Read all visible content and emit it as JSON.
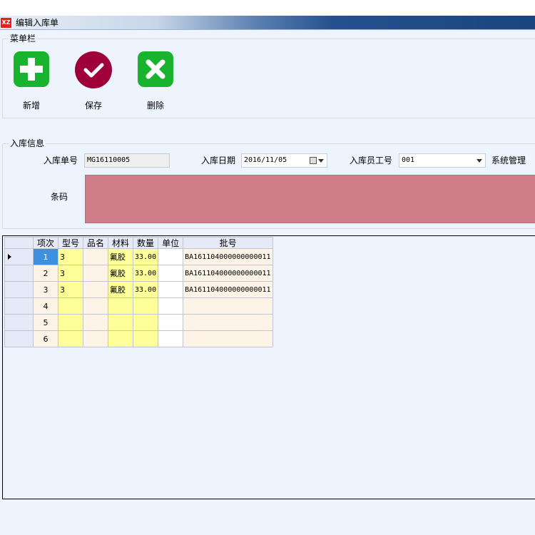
{
  "window": {
    "title": "编辑入库单",
    "app_icon_text": "XZ"
  },
  "menu": {
    "group_label": "菜单栏",
    "add_label": "新增",
    "save_label": "保存",
    "delete_label": "删除",
    "colors": {
      "add": "#1ab32f",
      "save": "#a0003a",
      "delete": "#1ab32f"
    }
  },
  "info": {
    "group_label": "入库信息",
    "order_no_label": "入库单号",
    "order_no_value": "MG16110005",
    "date_label": "入库日期",
    "date_value": "2016/11/05",
    "employee_label": "入库员工号",
    "employee_value": "001",
    "employee_name": "系统管理",
    "barcode_label": "条码",
    "barcode_color": "#cf7d88"
  },
  "grid": {
    "columns": [
      "项次",
      "型号",
      "品名",
      "材料",
      "数量",
      "单位",
      "批号"
    ],
    "rows": [
      {
        "seq": "1",
        "model": "3",
        "name": "",
        "material": "氟胶",
        "qty": "33.00",
        "unit": "",
        "batch": "BA161104000000000011"
      },
      {
        "seq": "2",
        "model": "3",
        "name": "",
        "material": "氟胶",
        "qty": "33.00",
        "unit": "",
        "batch": "BA161104000000000011"
      },
      {
        "seq": "3",
        "model": "3",
        "name": "",
        "material": "氟胶",
        "qty": "33.00",
        "unit": "",
        "batch": "BA161104000000000011"
      },
      {
        "seq": "4",
        "model": "",
        "name": "",
        "material": "",
        "qty": "",
        "unit": "",
        "batch": ""
      },
      {
        "seq": "5",
        "model": "",
        "name": "",
        "material": "",
        "qty": "",
        "unit": "",
        "batch": ""
      },
      {
        "seq": "6",
        "model": "",
        "name": "",
        "material": "",
        "qty": "",
        "unit": "",
        "batch": ""
      }
    ]
  }
}
